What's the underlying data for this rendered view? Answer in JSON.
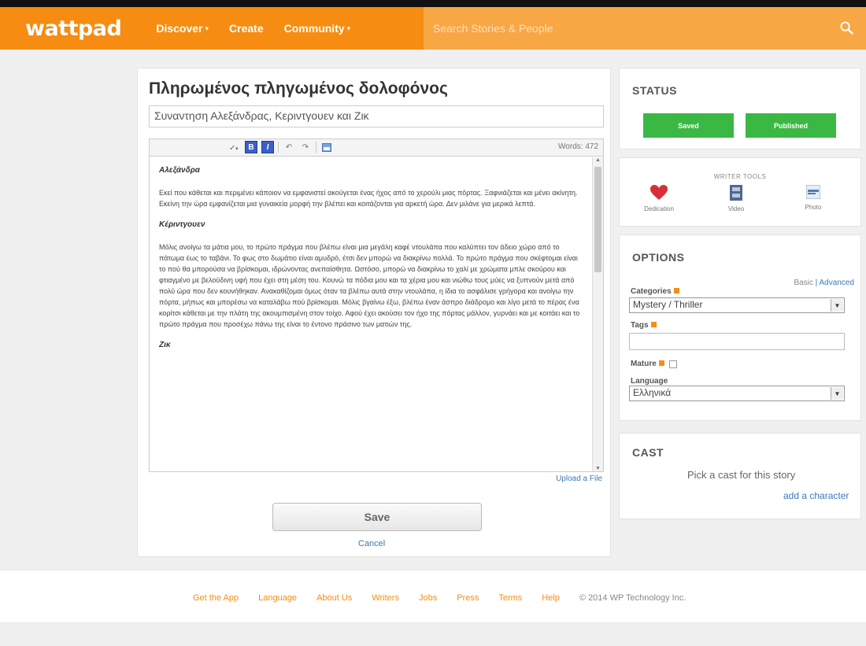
{
  "header": {
    "logo": "wattpad",
    "nav": [
      {
        "label": "Discover",
        "caret": "▾"
      },
      {
        "label": "Create",
        "caret": ""
      },
      {
        "label": "Community",
        "caret": "▾"
      }
    ],
    "search_placeholder": "Search Stories & People",
    "search_icon": "search-icon",
    "brand_color": "#f68d12"
  },
  "editor": {
    "story_title": "Πληρωμένος πληγωμένος δολοφόνος",
    "part_title": "Συναντηση Αλεξάνδρας, Κεριντγουεν και Ζικ",
    "word_count_label": "Words: 472",
    "toolbar": {
      "bold": "B",
      "italic": "I"
    },
    "content": [
      {
        "type": "heading",
        "text": "Αλεξάνδρα"
      },
      {
        "type": "para",
        "text": "Εκεί που κάθεται και περιμένει κάποιον να εμφανιστεί ακούγεται ένας ήχος από το χερούλι μιας πόρτας. Ξαφνιάζεται και μένει ακίνητη. Εκείνη την ώρα εμφανίζεται μια γυναικεία μορφή την βλέπει και κοιτάζονται για αρκετή ώρα. Δεν μιλάνε για μερικά λεπτά."
      },
      {
        "type": "heading",
        "text": "Κέριντγουεν"
      },
      {
        "type": "para",
        "text": "Μόλις ανοίγω τα μάτια μου, το πρώτο πράγμα που βλέπω είναι μια μεγάλη καφέ ντουλάπα που καλύπτει τον άδειο χώρο από το πάτωμα έως το ταβάνι. Το φως στο δωμάτιο είναι αμυδρό, έτσι δεν μπορώ να διακρίνω πολλά. Το πρώτο πράγμα που σκέφτομαι είναι το πού θα μπορούσα να βρίσκομαι, ιδρώνοντας ανεπαίσθητα. Ωστόσο, μπορώ να διακρίνω το χαλί με χρώματα μπλε σκούρου και φτιαγμένο με βελούδινη υφή που έχει στη μέση του. Κουνώ τα πόδια μου και τα χέρια μου και νιώθω τους μύες να ξυπνούν μετά από πολύ ώρα που δεν κουνήθηκαν. Ανακαθίζομαι όμως όταν τα βλέπω αυτά στην ντουλάπα, η ίδια το ασφάλισε γρήγορα και ανοίγω την πόρτα, μήπως και μπορέσω να καταλάβω πού βρίσκομαι. Μόλις βγαίνω έξω, βλέπω έναν άσπρο διάδρομο και λίγο μετά το πέρας ένα κορίτσι κάθεται με την πλάτη της ακουμπισμένη στον τοίχο. Αφού έχει ακούσει τον ήχο της πόρτας μάλλον, γυρνάει και με κοιτάει και το πρώτο πράγμα που προσέχω πάνω της είναι το έντονο πράσινο των ματιών της."
      },
      {
        "type": "heading",
        "text": "Ζικ"
      }
    ],
    "upload_label": "Upload a File",
    "save_label": "Save",
    "cancel_label": "Cancel"
  },
  "sidebar": {
    "status": {
      "heading": "STATUS",
      "saved_label": "Saved",
      "published_label": "Published",
      "button_color": "#3ab843"
    },
    "writer_tools": {
      "heading": "WRITER TOOLS",
      "tools": [
        {
          "label": "Dedication",
          "icon": "heart-icon"
        },
        {
          "label": "Video",
          "icon": "film-icon"
        },
        {
          "label": "Photo",
          "icon": "photo-icon"
        }
      ]
    },
    "options": {
      "heading": "OPTIONS",
      "basic_label": "Basic",
      "separator": " | ",
      "advanced_label": "Advanced",
      "categories_label": "Categories",
      "category_value": "Mystery / Thriller",
      "tags_label": "Tags",
      "tags_value": "",
      "mature_label": "Mature",
      "language_label": "Language",
      "language_value": "Ελληνικά"
    },
    "cast": {
      "heading": "CAST",
      "text": "Pick a cast for this story",
      "add_label": "add a character"
    }
  },
  "footer": {
    "links": [
      "Get the App",
      "Language",
      "About Us",
      "Writers",
      "Jobs",
      "Press",
      "Terms",
      "Help"
    ],
    "copyright": "© 2014 WP Technology Inc."
  }
}
